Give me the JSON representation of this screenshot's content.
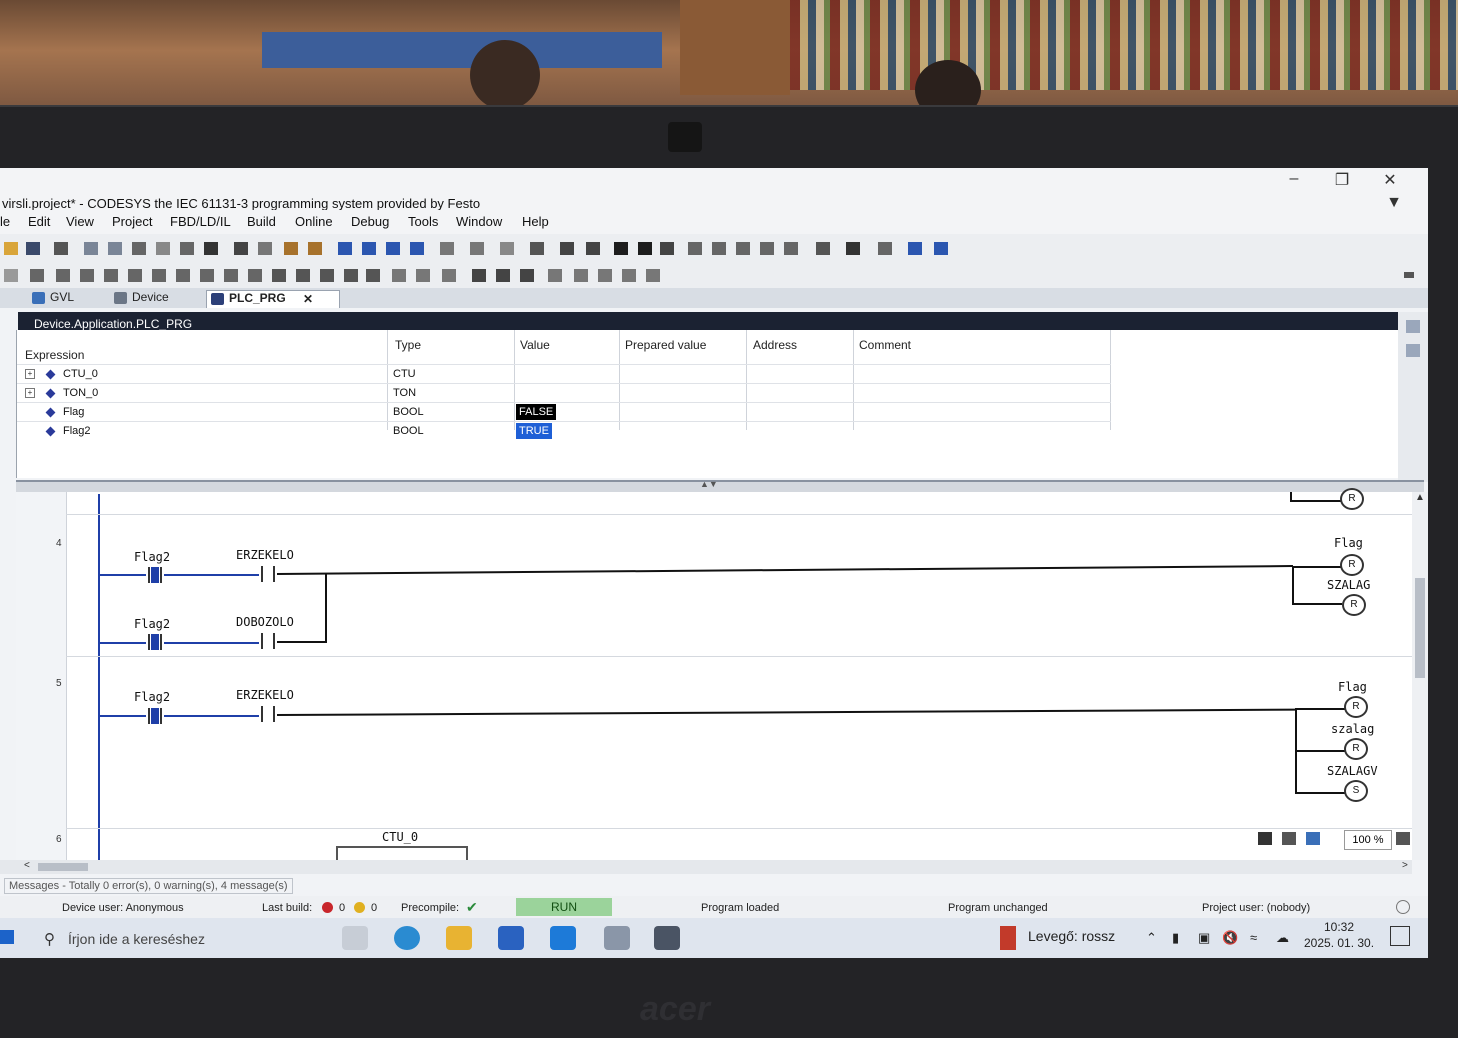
{
  "window": {
    "title": "virsli.project* - CODESYS the IEC 61131-3 programming system provided by Festo",
    "minimize": "–",
    "maximize": "❐",
    "close": "✕"
  },
  "menu": [
    "le",
    "Edit",
    "View",
    "Project",
    "FBD/LD/IL",
    "Build",
    "Online",
    "Debug",
    "Tools",
    "Window",
    "Help"
  ],
  "tabs": [
    {
      "label": "GVL"
    },
    {
      "label": "Device"
    },
    {
      "label": "PLC_PRG",
      "close": "✕"
    }
  ],
  "path": "Device.Application.PLC_PRG",
  "watch": {
    "headers": {
      "expression": "Expression",
      "type": "Type",
      "value": "Value",
      "prepared": "Prepared value",
      "address": "Address",
      "comment": "Comment"
    },
    "rows": [
      {
        "expr": "CTU_0",
        "type": "CTU",
        "value": ""
      },
      {
        "expr": "TON_0",
        "type": "TON",
        "value": ""
      },
      {
        "expr": "Flag",
        "type": "BOOL",
        "value": "FALSE"
      },
      {
        "expr": "Flag2",
        "type": "BOOL",
        "value": "TRUE"
      }
    ]
  },
  "ladder": {
    "rungs": [
      {
        "number": "4"
      },
      {
        "number": "5"
      },
      {
        "number": "6"
      }
    ],
    "labels": {
      "r4_c1": "Flag2",
      "r4_c2": "ERZEKELO",
      "r4_c3": "Flag2",
      "r4_c4": "DOBOZOLO",
      "r4_coil1": "Flag",
      "r4_coil2": "SZALAG",
      "r5_c1": "Flag2",
      "r5_c2": "ERZEKELO",
      "r5_coil1": "Flag",
      "r5_coil2": "szalag",
      "r5_coil3": "SZALAGV",
      "r6_fb": "CTU_0"
    },
    "coil_marks": {
      "r": "R",
      "s": "S"
    }
  },
  "zoom": "100 %",
  "messages": "Messages - Totally 0 error(s), 0 warning(s), 4 message(s)",
  "status": {
    "device_user": "Device user: Anonymous",
    "last_build": "Last build:",
    "errors": "0",
    "warnings": "0",
    "precompile": "Precompile:",
    "precompile_mark": "✔",
    "run": "RUN",
    "program_loaded": "Program loaded",
    "program_unchanged": "Program unchanged",
    "project_user": "Project user: (nobody)"
  },
  "taskbar": {
    "search_placeholder": "Írjon ide a kereséshez",
    "weather": "Levegő: rossz",
    "time": "10:32",
    "date": "2025. 01. 30."
  },
  "brand": "acer",
  "colors": {
    "run": "#9bd39b",
    "accent": "#1f3fa8",
    "true_bg": "#1e5fd6",
    "false_bg": "#000000"
  }
}
